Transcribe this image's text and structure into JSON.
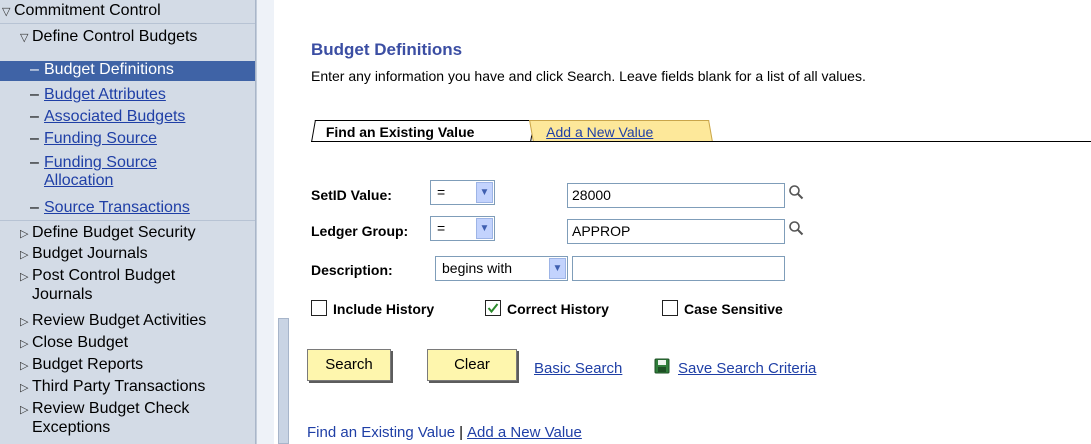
{
  "sidebar": {
    "root": "Commitment Control",
    "group": "Define Control Budgets",
    "selected": "Budget Definitions",
    "subitems": [
      "Budget Attributes",
      "Associated Budgets",
      "Funding Source",
      "Funding Source",
      "Allocation",
      "Source Transactions"
    ],
    "items": [
      "Define Budget Security",
      "Budget Journals",
      "Post Control Budget",
      "Journals",
      "Review Budget Activities",
      "Close Budget",
      "Budget Reports",
      "Third Party Transactions",
      "Review Budget Check",
      "Exceptions"
    ]
  },
  "page": {
    "title": "Budget Definitions",
    "instructions": "Enter any information you have and click Search. Leave fields blank for a list of all values."
  },
  "tabs": {
    "find": "Find an Existing Value",
    "add": "Add a New Value"
  },
  "form": {
    "setid_label": "SetID Value:",
    "setid_op": "=",
    "setid_value": "28000",
    "ledger_label": "Ledger Group:",
    "ledger_op": "=",
    "ledger_value": "APPROP",
    "desc_label": "Description:",
    "desc_op": "begins with",
    "desc_value": ""
  },
  "checkboxes": {
    "include_history": "Include History",
    "include_history_checked": false,
    "correct_history": "Correct History",
    "correct_history_checked": true,
    "case_sensitive": "Case Sensitive",
    "case_sensitive_checked": false
  },
  "actions": {
    "search": "Search",
    "clear": "Clear",
    "basic_search": "Basic Search",
    "save_criteria": "Save Search Criteria"
  },
  "footer": {
    "find": "Find an Existing Value",
    "separator": "|",
    "add": "Add a New Value"
  },
  "colors": {
    "sidebar_bg": "#d3dbe6",
    "selected_bg": "#3f63a6",
    "title": "#3b4ea3",
    "link": "#1f3fa6",
    "button_bg": "#fef6ad",
    "tab_bg": "#fde89a"
  }
}
